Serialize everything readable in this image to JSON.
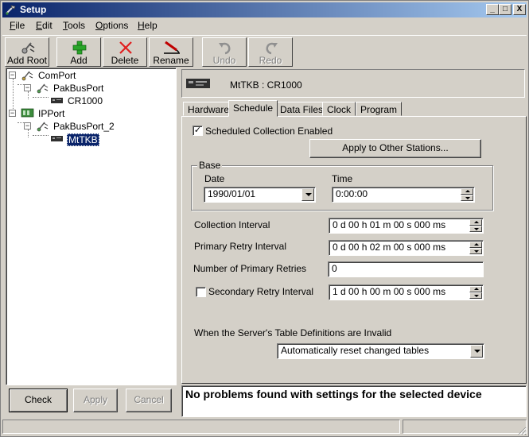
{
  "window": {
    "title": "Setup",
    "controls": {
      "minimize": "_",
      "maximize": "□",
      "close": "X"
    }
  },
  "menu": [
    {
      "label": "File",
      "accel": "F",
      "rest": "ile"
    },
    {
      "label": "Edit",
      "accel": "E",
      "rest": "dit"
    },
    {
      "label": "Tools",
      "accel": "T",
      "rest": "ools"
    },
    {
      "label": "Options",
      "accel": "O",
      "rest": "ptions"
    },
    {
      "label": "Help",
      "accel": "H",
      "rest": "elp"
    }
  ],
  "toolbar": {
    "add_root": {
      "label": "Add Root",
      "icon": "add-root-icon",
      "enabled": true
    },
    "add": {
      "label": "Add",
      "icon": "plus-icon",
      "enabled": true
    },
    "delete": {
      "label": "Delete",
      "icon": "x-icon",
      "enabled": true
    },
    "rename": {
      "label": "Rename",
      "icon": "rename-icon",
      "enabled": true
    },
    "undo": {
      "label": "Undo",
      "icon": "undo-icon",
      "enabled": false
    },
    "redo": {
      "label": "Redo",
      "icon": "redo-icon",
      "enabled": false
    }
  },
  "tree": [
    {
      "label": "ComPort",
      "icon": "comport-icon",
      "expanded": true,
      "depth": 0
    },
    {
      "label": "PakBusPort",
      "icon": "pakbusport-icon",
      "expanded": true,
      "depth": 1
    },
    {
      "label": "CR1000",
      "icon": "datalogger-icon",
      "depth": 2
    },
    {
      "label": "IPPort",
      "icon": "ipport-icon",
      "expanded": true,
      "depth": 0
    },
    {
      "label": "PakBusPort_2",
      "icon": "pakbusport-icon",
      "expanded": true,
      "depth": 1
    },
    {
      "label": "MtTKB",
      "icon": "datalogger-icon",
      "depth": 2,
      "selected": true
    }
  ],
  "left_buttons": {
    "check": {
      "label": "Check",
      "enabled": true
    },
    "apply": {
      "label": "Apply",
      "enabled": false
    },
    "cancel": {
      "label": "Cancel",
      "enabled": false
    }
  },
  "device": {
    "name": "MtTKB : CR1000",
    "icon": "datalogger-icon"
  },
  "tabs": [
    {
      "label": "Hardware",
      "active": false
    },
    {
      "label": "Schedule",
      "active": true
    },
    {
      "label": "Data Files",
      "active": false
    },
    {
      "label": "Clock",
      "active": false
    },
    {
      "label": "Program",
      "active": false
    }
  ],
  "schedule": {
    "scheduled_enabled": {
      "label": "Scheduled Collection Enabled",
      "checked": true
    },
    "apply_other_label": "Apply to Other Stations...",
    "base": {
      "legend": "Base",
      "date_label": "Date",
      "date_value": "1990/01/01",
      "time_label": "Time",
      "time_value": "0:00:00"
    },
    "collection_interval": {
      "label": "Collection Interval",
      "value": "0 d 00 h 01 m 00 s 000 ms"
    },
    "primary_retry": {
      "label": "Primary Retry Interval",
      "value": "0 d 00 h 02 m 00 s 000 ms"
    },
    "num_primary_retries": {
      "label": "Number of Primary Retries",
      "value": "0"
    },
    "secondary_retry": {
      "label": "Secondary Retry Interval",
      "value": "1 d 00 h 00 m 00 s 000 ms",
      "checked": false
    },
    "table_defs": {
      "label": "When the Server's Table Definitions are Invalid",
      "value": "Automatically reset changed tables"
    }
  },
  "message": "No problems found with settings for the selected device"
}
